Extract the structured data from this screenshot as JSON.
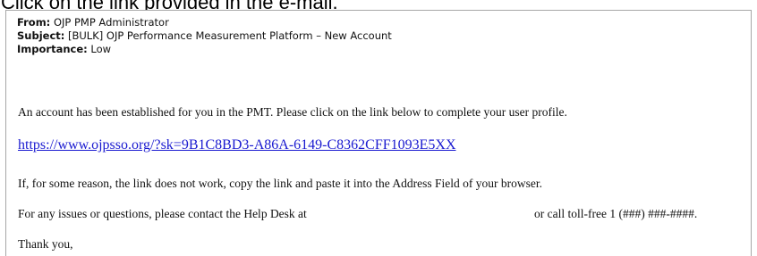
{
  "instruction": "Click on the link provided in the e-mail.",
  "email": {
    "from_label": "From:",
    "from_value": "OJP PMP Administrator",
    "subject_label": "Subject:",
    "subject_value": "[BULK] OJP Performance Measurement Platform – New Account",
    "importance_label": "Importance:",
    "importance_value": "Low",
    "intro": "An account has been established for you in the PMT. Please click on the link below to complete your user profile.",
    "link": "https://www.ojpsso.org/?sk=9B1C8BD3-A86A-6149-C8362CFF1093E5XX",
    "fallback": "If, for some reason, the link does not work, copy the link and paste it into the Address Field of your browser.",
    "helpdesk": "For any issues or questions, please contact the Help Desk at",
    "phone": "or call toll-free 1 (###) ###-####.",
    "closing": "Thank you,"
  }
}
